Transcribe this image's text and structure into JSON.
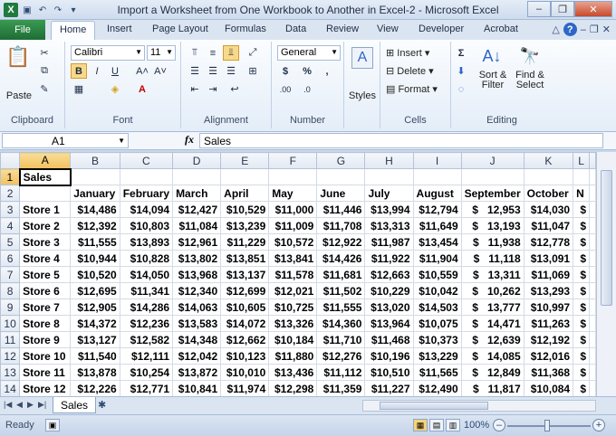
{
  "window": {
    "title": "Import a Worksheet from One Workbook to Another in Excel-2 - Microsoft Excel"
  },
  "tabs": [
    "File",
    "Home",
    "Insert",
    "Page Layout",
    "Formulas",
    "Data",
    "Review",
    "View",
    "Developer",
    "Acrobat"
  ],
  "ribbon": {
    "clipboard": {
      "label": "Clipboard",
      "paste": "Paste"
    },
    "font": {
      "label": "Font",
      "name": "Calibri",
      "size": "11",
      "bold": "B",
      "italic": "I",
      "underline": "U"
    },
    "alignment": {
      "label": "Alignment"
    },
    "number": {
      "label": "Number",
      "format": "General",
      "currency": "$",
      "percent": "%",
      "comma": ","
    },
    "styles": {
      "label": "Styles"
    },
    "cells": {
      "label": "Cells",
      "insert": "Insert",
      "delete": "Delete",
      "format": "Format"
    },
    "editing": {
      "label": "Editing",
      "sum": "Σ",
      "sort": "Sort &",
      "filter": "Filter",
      "find": "Find &",
      "select": "Select"
    }
  },
  "formula_bar": {
    "name_box": "A1",
    "fx": "fx",
    "value": "Sales"
  },
  "columns": [
    "A",
    "B",
    "C",
    "D",
    "E",
    "F",
    "G",
    "H",
    "I",
    "J",
    "K",
    "L"
  ],
  "rows": [
    {
      "n": "1",
      "cells": [
        "Sales",
        "",
        "",
        "",
        "",
        "",
        "",
        "",
        "",
        "",
        "",
        ""
      ]
    },
    {
      "n": "2",
      "cells": [
        "",
        "January",
        "February",
        "March",
        "April",
        "May",
        "June",
        "July",
        "August",
        "September",
        "October",
        "N"
      ]
    },
    {
      "n": "3",
      "cells": [
        "Store 1",
        "$14,486",
        "$14,094",
        "$12,427",
        "$10,529",
        "$11,000",
        "$11,446",
        "$13,994",
        "$12,794",
        "$   12,953",
        "$14,030",
        "$"
      ]
    },
    {
      "n": "4",
      "cells": [
        "Store 2",
        "$12,392",
        "$10,803",
        "$11,084",
        "$13,239",
        "$11,009",
        "$11,708",
        "$13,313",
        "$11,649",
        "$   13,193",
        "$11,047",
        "$"
      ]
    },
    {
      "n": "5",
      "cells": [
        "Store 3",
        "$11,555",
        "$13,893",
        "$12,961",
        "$11,229",
        "$10,572",
        "$12,922",
        "$11,987",
        "$13,454",
        "$   11,938",
        "$12,778",
        "$"
      ]
    },
    {
      "n": "6",
      "cells": [
        "Store 4",
        "$10,944",
        "$10,828",
        "$13,802",
        "$13,851",
        "$13,841",
        "$14,426",
        "$11,922",
        "$11,904",
        "$   11,118",
        "$13,091",
        "$"
      ]
    },
    {
      "n": "7",
      "cells": [
        "Store 5",
        "$10,520",
        "$14,050",
        "$13,968",
        "$13,137",
        "$11,578",
        "$11,681",
        "$12,663",
        "$10,559",
        "$   13,311",
        "$11,069",
        "$"
      ]
    },
    {
      "n": "8",
      "cells": [
        "Store 6",
        "$12,695",
        "$11,341",
        "$12,340",
        "$12,699",
        "$12,021",
        "$11,502",
        "$10,229",
        "$10,042",
        "$   10,262",
        "$13,293",
        "$"
      ]
    },
    {
      "n": "9",
      "cells": [
        "Store 7",
        "$12,905",
        "$14,286",
        "$14,063",
        "$10,605",
        "$10,725",
        "$11,555",
        "$13,020",
        "$14,503",
        "$   13,777",
        "$10,997",
        "$"
      ]
    },
    {
      "n": "10",
      "cells": [
        "Store 8",
        "$14,372",
        "$12,236",
        "$13,583",
        "$14,072",
        "$13,326",
        "$14,360",
        "$13,964",
        "$10,075",
        "$   14,471",
        "$11,263",
        "$"
      ]
    },
    {
      "n": "11",
      "cells": [
        "Store 9",
        "$13,127",
        "$12,582",
        "$14,348",
        "$12,662",
        "$10,184",
        "$11,710",
        "$11,468",
        "$10,373",
        "$   12,639",
        "$12,192",
        "$"
      ]
    },
    {
      "n": "12",
      "cells": [
        "Store 10",
        "$11,540",
        "$12,111",
        "$12,042",
        "$10,123",
        "$11,880",
        "$12,276",
        "$10,196",
        "$13,229",
        "$   14,085",
        "$12,016",
        "$"
      ]
    },
    {
      "n": "13",
      "cells": [
        "Store 11",
        "$13,878",
        "$10,254",
        "$13,872",
        "$10,010",
        "$13,436",
        "$11,112",
        "$10,510",
        "$11,565",
        "$   12,849",
        "$11,368",
        "$"
      ]
    },
    {
      "n": "14",
      "cells": [
        "Store 12",
        "$12,226",
        "$12,771",
        "$10,841",
        "$11,974",
        "$12,298",
        "$11,359",
        "$11,227",
        "$12,490",
        "$   11,817",
        "$10,084",
        "$"
      ]
    }
  ],
  "sheet_tabs": [
    "Sales"
  ],
  "status": {
    "text": "Ready",
    "zoom": "100%"
  }
}
